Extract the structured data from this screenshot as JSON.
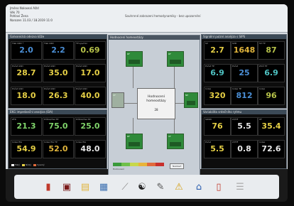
{
  "header": {
    "info": [
      "Jméno    Naloxeal Alžd",
      "Věk      70",
      "Pohlaví  Žena",
      "Narozen  11.03 / 18.2019  11:0"
    ],
    "message": "Souhrnné zobrazení hemodynamiky - bez upozornění"
  },
  "panels": {
    "left_top": {
      "title": "Galvanická odezva kůže",
      "cells": [
        {
          "label": "Tlak GSD *",
          "value": "2.0",
          "color": "blue"
        },
        {
          "label": "Tlak GSD",
          "value": "2.2",
          "color": "blue"
        },
        {
          "label": "TP sys/min",
          "value": "0.69",
          "color": "olive"
        },
        {
          "label": "Počet GSD",
          "value": "28.7",
          "color": "yellow"
        },
        {
          "label": "Počet GSD",
          "value": "35.0",
          "color": "yellow"
        },
        {
          "label": "Počet GSD",
          "value": "17.0",
          "color": "yellow"
        },
        {
          "label": "Počet GSD",
          "value": "18.0",
          "color": "yellow"
        },
        {
          "label": "Počet GSD",
          "value": "26.3",
          "color": "yellow"
        },
        {
          "label": "Počet GSD",
          "value": "40.0",
          "color": "yellow"
        }
      ]
    },
    "left_bottom": {
      "title": "EKG impedanční analýza (EIA)",
      "cells": [
        {
          "label": "ZTK",
          "value": "21.3",
          "color": "green"
        },
        {
          "label": "Průtok/čas TP",
          "value": "75.0",
          "color": "green"
        },
        {
          "label": "Průtok/čas TP",
          "value": "25.0",
          "color": "green"
        },
        {
          "label": "Index EIA",
          "value": "54.9",
          "color": "yellow"
        },
        {
          "label": "Index EIA TP",
          "value": "52.0",
          "color": "orange"
        },
        {
          "label": "Index EIA",
          "value": "48.0",
          "color": "white"
        }
      ]
    },
    "right_top": {
      "title": "Signální pulzní analýza s SIPS",
      "cells": [
        {
          "label": "SV",
          "value": "2.7",
          "color": "yellow"
        },
        {
          "label": "SVR",
          "value": "1648",
          "color": "orange"
        },
        {
          "label": "SV TP",
          "value": "87",
          "color": "olive"
        },
        {
          "label": "Počet TP",
          "value": "6.9",
          "color": "teal"
        },
        {
          "label": "Počet",
          "value": "25",
          "color": "blue"
        },
        {
          "label": "Zdrž TP",
          "value": "6.9",
          "color": "teal"
        },
        {
          "label": "Index",
          "value": "320",
          "color": "yellow"
        },
        {
          "label": "Index TP",
          "value": "812",
          "color": "blue"
        },
        {
          "label": "Index",
          "value": "96",
          "color": "olive"
        }
      ]
    },
    "right_bottom": {
      "title": "Variabilita srdečního rytmu",
      "cells": [
        {
          "label": "SDNN",
          "value": "76",
          "color": "yellow"
        },
        {
          "label": "LF/HF",
          "value": "5.5",
          "color": "white"
        },
        {
          "label": "HF",
          "value": "35.4",
          "color": "yellow"
        },
        {
          "label": "Počet",
          "value": "5.5",
          "color": "yellow"
        },
        {
          "label": "LF/HF",
          "value": "0.8",
          "color": "white"
        },
        {
          "label": "Index",
          "value": "72.6",
          "color": "white"
        }
      ]
    },
    "center": {
      "title": "Hodnocení homeostázy",
      "hub_title": "Hodnocení homeostázy",
      "hub_value": "28",
      "nodes": [
        "RF",
        "RF",
        "NP",
        "RF",
        "VF",
        "CF"
      ],
      "scale_label": "Hodnocení",
      "button": "Nastavit"
    }
  },
  "legend": [
    "Malý",
    "Nízký",
    "Vysoký"
  ],
  "colors": {
    "blue": "#4b8fd6",
    "yellow": "#e6d046",
    "green": "#7fd36a",
    "orange": "#e0b43c",
    "olive": "#b7c34a",
    "white": "#e8e8e8",
    "teal": "#4fc3c3"
  },
  "toolbar": {
    "icons": [
      "document-icon",
      "heart-monitor-icon",
      "notepad-icon",
      "report-icon",
      "ruler-icon",
      "yin-yang-icon",
      "pen-icon",
      "warning-icon",
      "home-icon",
      "files-icon",
      "menu-icon"
    ]
  }
}
